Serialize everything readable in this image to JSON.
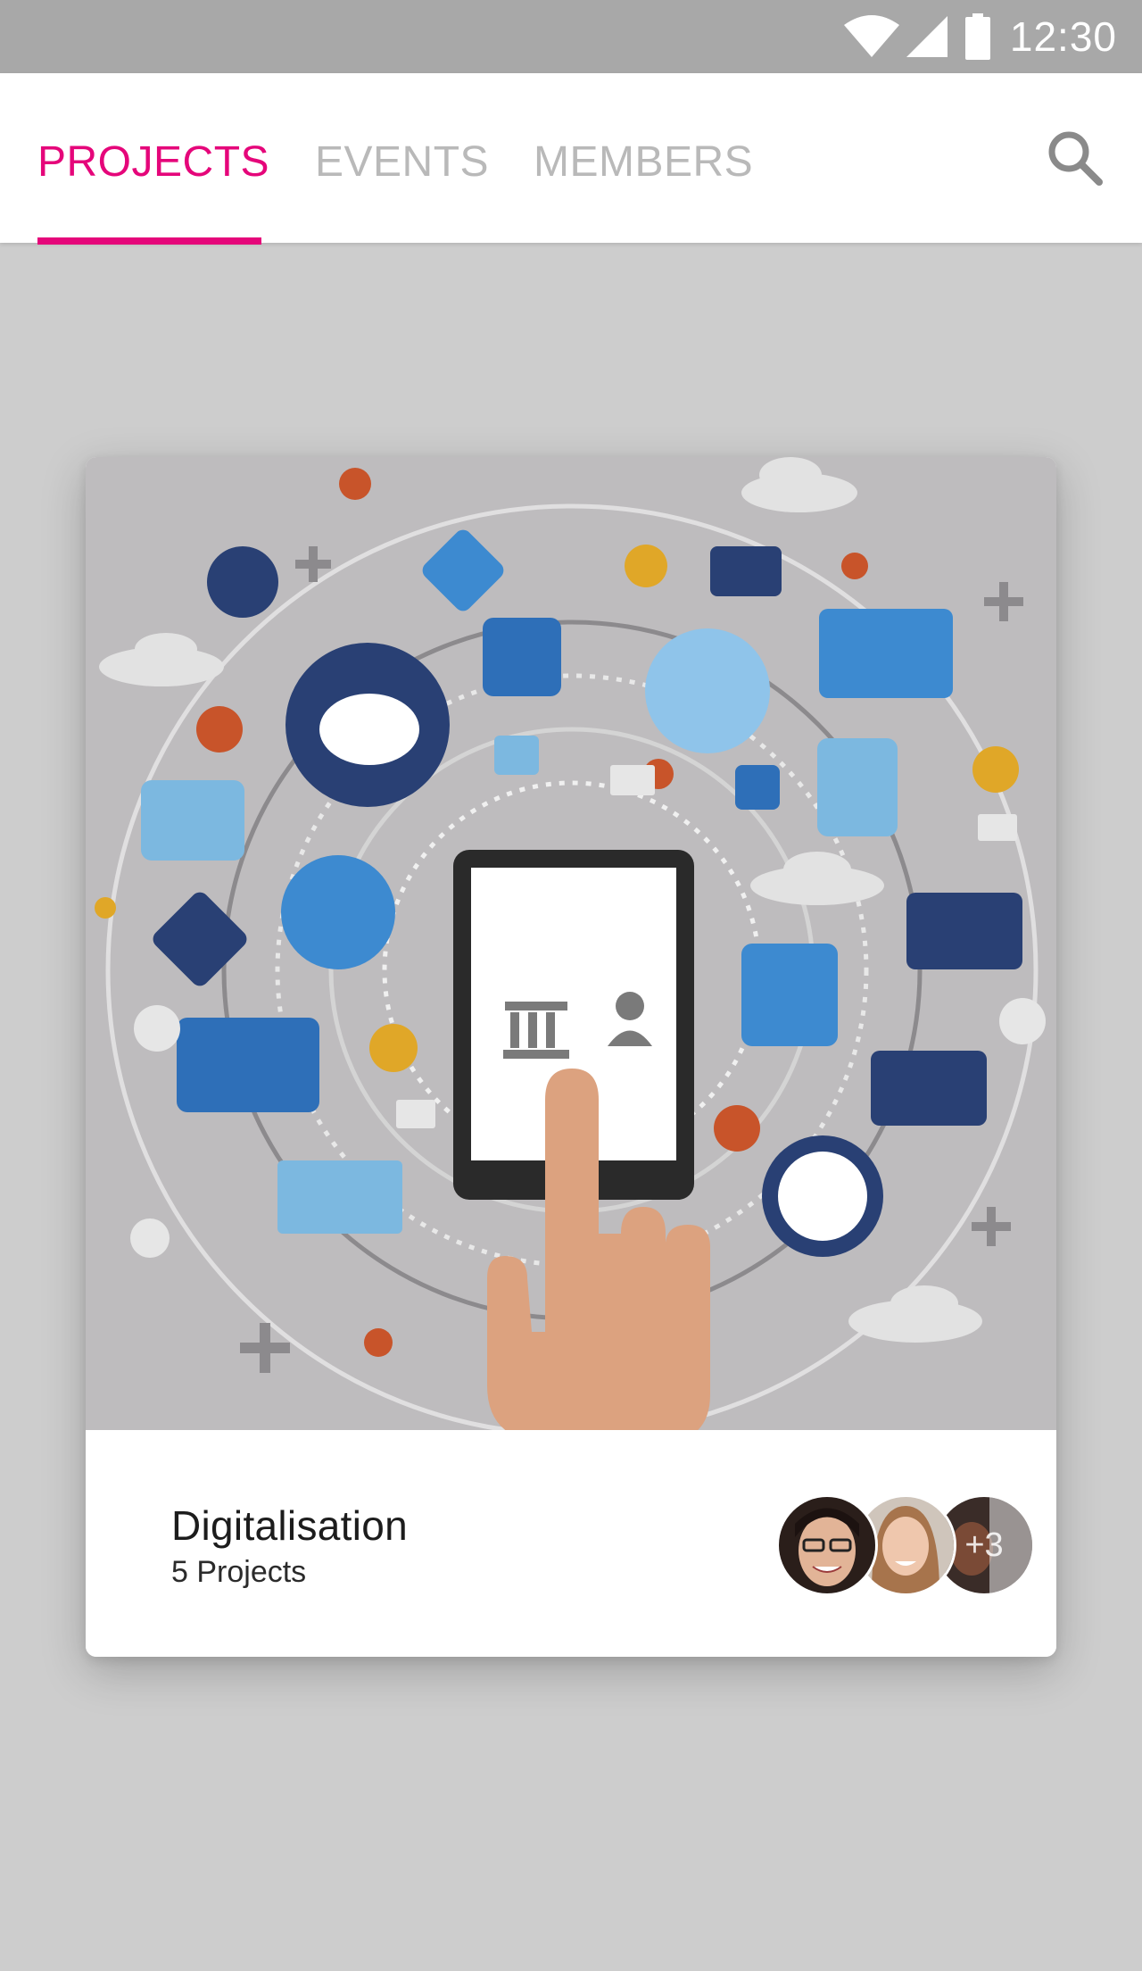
{
  "status_bar": {
    "time": "12:30",
    "icons": [
      "wifi-icon",
      "cell-signal-icon",
      "battery-icon"
    ]
  },
  "tabs": [
    {
      "label": "PROJECTS",
      "active": true
    },
    {
      "label": "EVENTS",
      "active": false
    },
    {
      "label": "MEMBERS",
      "active": false
    }
  ],
  "toolbar": {
    "search_icon": "search-icon"
  },
  "colors": {
    "accent": "#e5067a",
    "status_bar": "#a8a8a8",
    "page_background": "#cdcdcd",
    "inactive_tab": "#b9b9b9"
  },
  "card": {
    "image_icon": "digital-banking-illustration",
    "title": "Digitalisation",
    "subtitle": "5 Projects",
    "avatars": {
      "more_label": "+3"
    }
  }
}
